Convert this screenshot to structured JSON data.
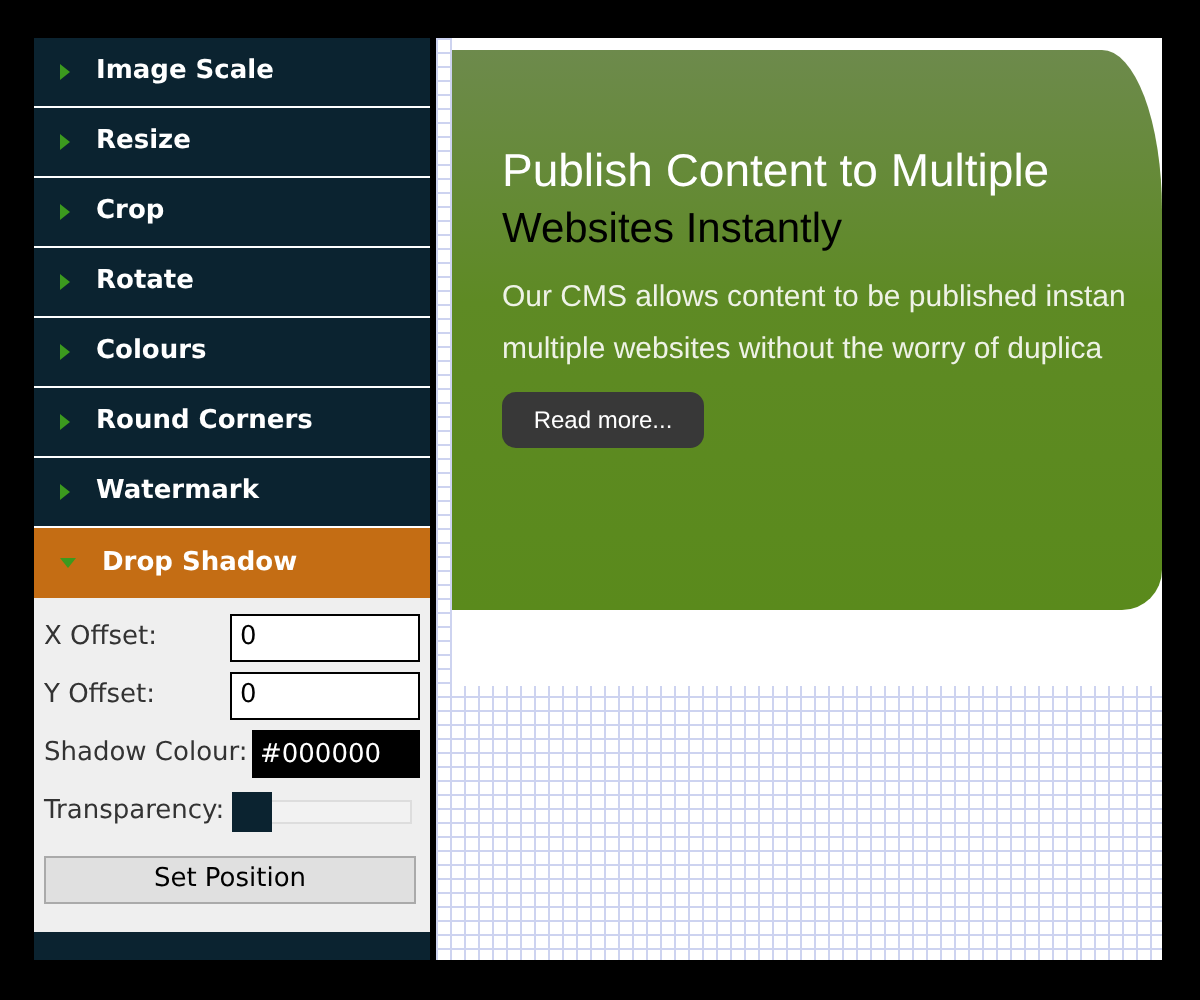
{
  "sidebar": {
    "items": [
      {
        "label": "Image Scale",
        "expanded": false
      },
      {
        "label": "Resize",
        "expanded": false
      },
      {
        "label": "Crop",
        "expanded": false
      },
      {
        "label": "Rotate",
        "expanded": false
      },
      {
        "label": "Colours",
        "expanded": false
      },
      {
        "label": "Round Corners",
        "expanded": false
      },
      {
        "label": "Watermark",
        "expanded": false
      },
      {
        "label": "Drop Shadow",
        "expanded": true
      }
    ],
    "panel": {
      "fields": [
        {
          "kind": "text",
          "label": "X Offset:",
          "value": "0"
        },
        {
          "kind": "text",
          "label": "Y Offset:",
          "value": "0"
        },
        {
          "kind": "color",
          "label": "Shadow Colour:",
          "value": "#000000"
        },
        {
          "kind": "slider",
          "label": "Transparency:",
          "level": 0
        }
      ],
      "button": "Set Position"
    }
  },
  "banner": {
    "title": "Publish Content to Multiple",
    "subtitle": "Websites Instantly",
    "lines": [
      "Our CMS allows content to be published instan",
      "multiple websites without the worry of duplica"
    ],
    "button": "Read more..."
  }
}
